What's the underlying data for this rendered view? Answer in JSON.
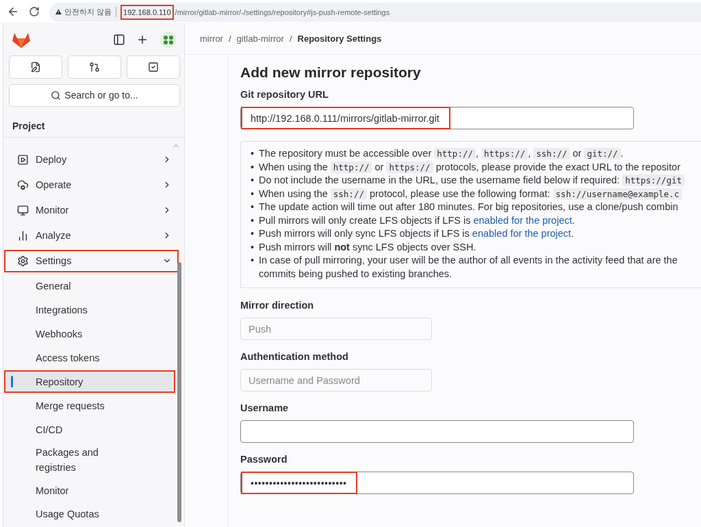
{
  "browser": {
    "security_label": "안전하지 않음",
    "url_host": "192.168.0.110",
    "url_path": "/mirror/gitlab-mirror/-/settings/repository#js-push-remote-settings",
    "host_highlighted": true
  },
  "sidebar": {
    "search_placeholder": "Search or go to...",
    "section_title": "Project",
    "items": [
      {
        "label": "Deploy",
        "expanded": false,
        "highlighted": false
      },
      {
        "label": "Operate",
        "expanded": false,
        "highlighted": false
      },
      {
        "label": "Monitor",
        "expanded": false,
        "highlighted": false
      },
      {
        "label": "Analyze",
        "expanded": false,
        "highlighted": false
      },
      {
        "label": "Settings",
        "expanded": true,
        "highlighted": true,
        "children": [
          {
            "label": "General",
            "selected": false,
            "highlighted": false
          },
          {
            "label": "Integrations",
            "selected": false,
            "highlighted": false
          },
          {
            "label": "Webhooks",
            "selected": false,
            "highlighted": false
          },
          {
            "label": "Access tokens",
            "selected": false,
            "highlighted": false
          },
          {
            "label": "Repository",
            "selected": true,
            "highlighted": true
          },
          {
            "label": "Merge requests",
            "selected": false,
            "highlighted": false
          },
          {
            "label": "CI/CD",
            "selected": false,
            "highlighted": false
          },
          {
            "label": "Packages and registries",
            "selected": false,
            "highlighted": false
          },
          {
            "label": "Monitor",
            "selected": false,
            "highlighted": false
          },
          {
            "label": "Usage Quotas",
            "selected": false,
            "highlighted": false
          }
        ]
      }
    ]
  },
  "breadcrumbs": {
    "separator": "/",
    "items": [
      {
        "label": "mirror",
        "current": false
      },
      {
        "label": "gitlab-mirror",
        "current": false
      },
      {
        "label": "Repository Settings",
        "current": true
      }
    ]
  },
  "form": {
    "title": "Add new mirror repository",
    "url_label": "Git repository URL",
    "url_value": "http://192.168.0.111/mirrors/gitlab-mirror.git",
    "url_highlighted": true,
    "bullet": "•",
    "notes": [
      [
        {
          "kind": "text",
          "text": "The repository must be accessible over "
        },
        {
          "kind": "code",
          "text": "http://"
        },
        {
          "kind": "text",
          "text": ", "
        },
        {
          "kind": "code",
          "text": "https://"
        },
        {
          "kind": "text",
          "text": ", "
        },
        {
          "kind": "code",
          "text": "ssh://"
        },
        {
          "kind": "text",
          "text": " or "
        },
        {
          "kind": "code",
          "text": "git://"
        },
        {
          "kind": "text",
          "text": "."
        }
      ],
      [
        {
          "kind": "text",
          "text": "When using the "
        },
        {
          "kind": "code",
          "text": "http://"
        },
        {
          "kind": "text",
          "text": " or "
        },
        {
          "kind": "code",
          "text": "https://"
        },
        {
          "kind": "text",
          "text": " protocols, please provide the exact URL to the repositor"
        }
      ],
      [
        {
          "kind": "text",
          "text": "Do not include the username in the URL, use the username field below if required: "
        },
        {
          "kind": "code",
          "text": "https://git"
        }
      ],
      [
        {
          "kind": "text",
          "text": "When using the "
        },
        {
          "kind": "code",
          "text": "ssh://"
        },
        {
          "kind": "text",
          "text": " protocol, please use the following format: "
        },
        {
          "kind": "code",
          "text": "ssh://username@example.c"
        }
      ],
      [
        {
          "kind": "text",
          "text": "The update action will time out after 180 minutes. For big repositories, use a clone/push combin"
        }
      ],
      [
        {
          "kind": "text",
          "text": "Pull mirrors will only create LFS objects if LFS is "
        },
        {
          "kind": "link",
          "text": "enabled for the project"
        },
        {
          "kind": "text",
          "text": "."
        }
      ],
      [
        {
          "kind": "text",
          "text": "Push mirrors will only sync LFS objects if LFS is "
        },
        {
          "kind": "link",
          "text": "enabled for the project"
        },
        {
          "kind": "text",
          "text": "."
        }
      ],
      [
        {
          "kind": "text",
          "text": "Push mirrors will "
        },
        {
          "kind": "bold",
          "text": "not"
        },
        {
          "kind": "text",
          "text": " sync LFS objects over SSH."
        }
      ],
      [
        {
          "kind": "text",
          "text": "In case of pull mirroring, your user will be the author of all events in the activity feed that are the commits being pushed to existing branches."
        }
      ]
    ],
    "fields": [
      {
        "label": "Mirror direction",
        "kind": "select",
        "value": "Push",
        "disabled": true
      },
      {
        "label": "Authentication method",
        "kind": "select",
        "value": "Username and Password",
        "disabled": true
      },
      {
        "label": "Username",
        "kind": "input"
      },
      {
        "label": "Password",
        "kind": "password",
        "value": "••••••••••••••••••••••••••",
        "highlighted": true
      }
    ]
  }
}
